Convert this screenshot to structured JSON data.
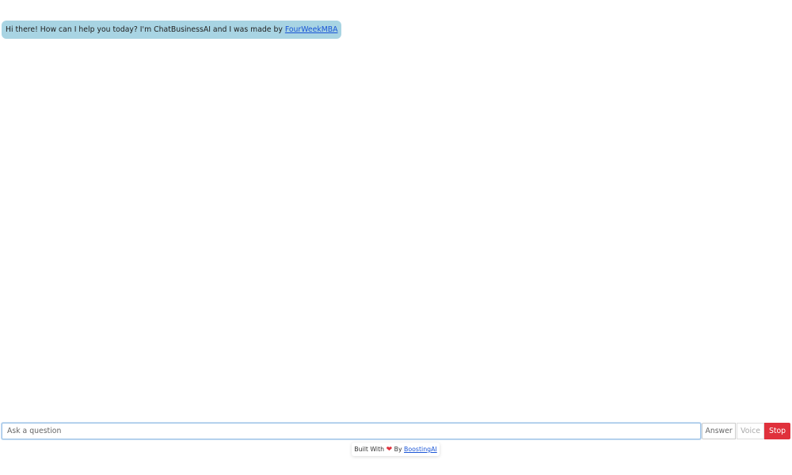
{
  "chat": {
    "messages": [
      {
        "role": "assistant",
        "text": "Hi there! How can I help you today? I'm ChatBusinessAI and I was made by ",
        "link_text": "FourWeekMBA"
      }
    ]
  },
  "composer": {
    "placeholder": "Ask a question",
    "value": "",
    "answer_label": "Answer",
    "voice_label": "Voice",
    "stop_label": "Stop"
  },
  "footer": {
    "prefix": "Built With ",
    "heart_icon": "heart-icon",
    "middle": " By ",
    "link_text": "BoostingAI"
  },
  "colors": {
    "bubble_bg": "#a8d4e3",
    "stop_bg": "#e0313c",
    "link": "#1a55d6"
  }
}
